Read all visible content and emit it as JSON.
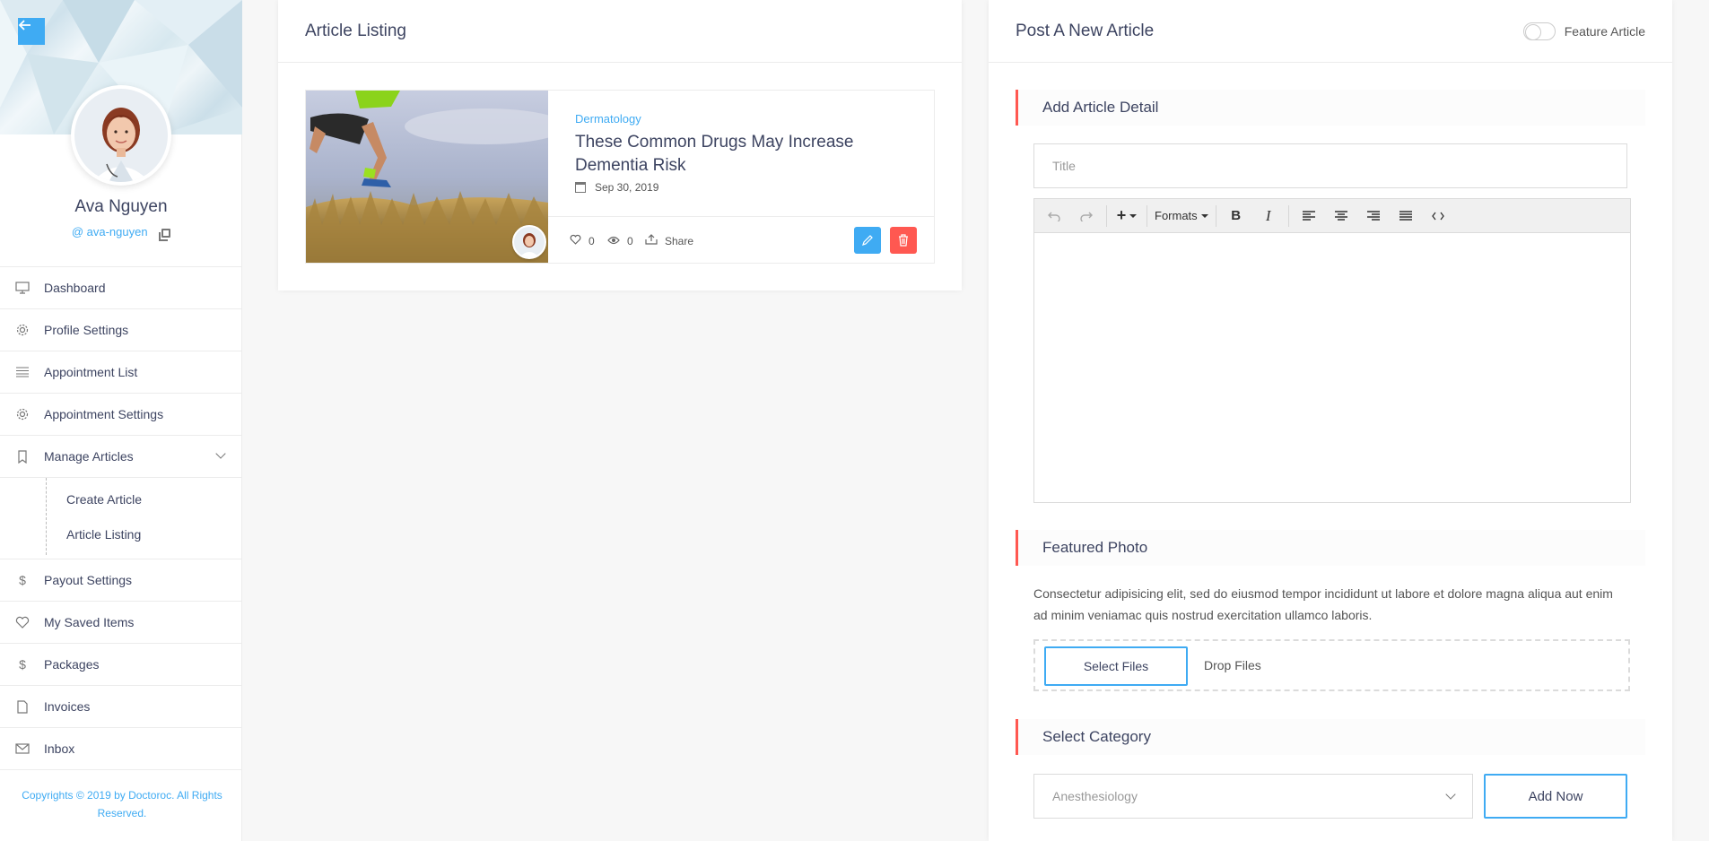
{
  "sidebar": {
    "back_icon": "arrow-left-icon",
    "profile": {
      "name": "Ava Nguyen",
      "handle": "@ ava-nguyen"
    },
    "nav": [
      {
        "label": "Dashboard",
        "icon": "monitor-icon"
      },
      {
        "label": "Profile Settings",
        "icon": "gear-icon"
      },
      {
        "label": "Appointment List",
        "icon": "list-icon"
      },
      {
        "label": "Appointment Settings",
        "icon": "gear-icon"
      },
      {
        "label": "Manage Articles",
        "icon": "bookmark-icon",
        "expanded": true,
        "children": [
          {
            "label": "Create Article"
          },
          {
            "label": "Article Listing"
          }
        ]
      },
      {
        "label": "Payout Settings",
        "icon": "dollar-icon"
      },
      {
        "label": "My Saved Items",
        "icon": "heart-icon"
      },
      {
        "label": "Packages",
        "icon": "dollar-icon"
      },
      {
        "label": "Invoices",
        "icon": "document-icon"
      },
      {
        "label": "Inbox",
        "icon": "envelope-icon"
      }
    ],
    "copyright": "Copyrights © 2019 by Doctoroc. All Rights Reserved."
  },
  "listing": {
    "title": "Article Listing",
    "articles": [
      {
        "category": "Dermatology",
        "title": "These Common Drugs May Increase Dementia Risk",
        "date": "Sep 30, 2019",
        "likes": "0",
        "views": "0",
        "share_label": "Share"
      }
    ]
  },
  "post": {
    "title": "Post A New Article",
    "feature_toggle_label": "Feature Article",
    "feature_enabled": false,
    "detail_section": "Add Article Detail",
    "title_placeholder": "Title",
    "editor_toolbar": {
      "formats_label": "Formats"
    },
    "photo_section": "Featured Photo",
    "photo_description": "Consectetur adipisicing elit, sed do eiusmod tempor incididunt ut labore et dolore magna aliqua aut enim ad minim veniamac quis nostrud exercitation ullamco laboris.",
    "select_files_label": "Select Files",
    "drop_files_label": "Drop Files",
    "category_section": "Select Category",
    "category_selected": "Anesthesiology",
    "add_now_label": "Add Now"
  },
  "colors": {
    "accent": "#3fabf3",
    "danger": "#ff5851",
    "text": "#3d4461"
  }
}
